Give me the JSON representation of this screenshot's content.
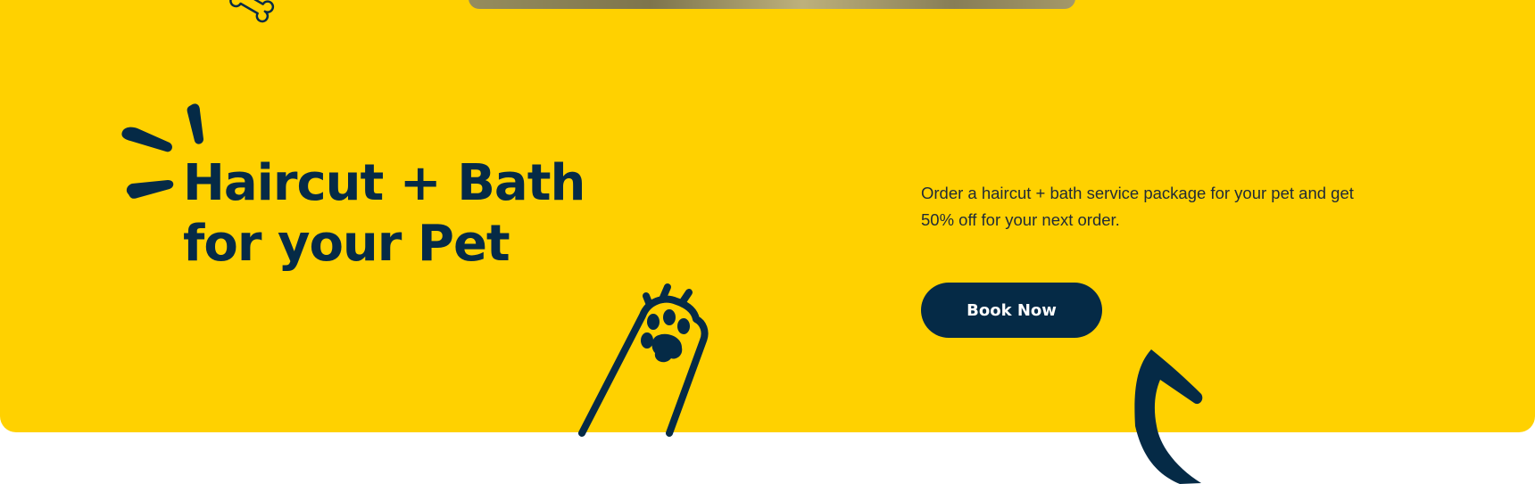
{
  "hero": {
    "title": "Haircut + Bath for your Pet",
    "description": "Order a haircut + bath service package for your pet and get 50% off for your next order.",
    "cta_label": "Book Now"
  },
  "colors": {
    "background": "#ffd100",
    "primary": "#052a46",
    "text": "#1f2a36",
    "page": "#ffffff"
  },
  "icons": [
    "bone-icon",
    "sparkle-lines-icon",
    "paw-arm-icon",
    "curved-arrow-icon"
  ]
}
